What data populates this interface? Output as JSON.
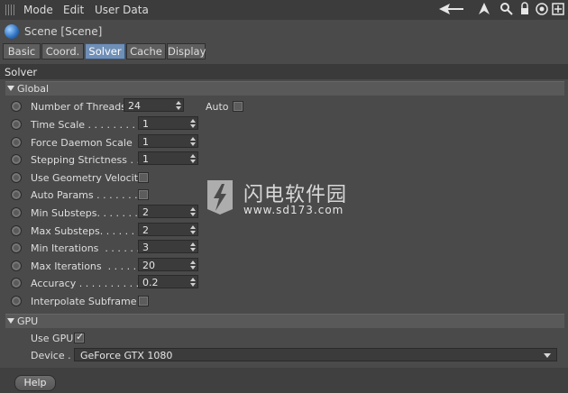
{
  "menu": {
    "items": [
      "Mode",
      "Edit",
      "User Data"
    ]
  },
  "scene": {
    "title": "Scene [Scene]"
  },
  "tabs": [
    {
      "label": "Basic"
    },
    {
      "label": "Coord."
    },
    {
      "label": "Solver",
      "active": true
    },
    {
      "label": "Cache"
    },
    {
      "label": "Display"
    }
  ],
  "solver": {
    "section_title": "Solver",
    "global_title": "Global",
    "threads": {
      "label": "Number of Threads",
      "value": "24",
      "auto_label": "Auto"
    },
    "rows": [
      {
        "label": "Time Scale . . . . . . . . . .",
        "value": "1"
      },
      {
        "label": "Force Daemon Scale  .",
        "value": "1"
      },
      {
        "label": "Stepping Strictness . .",
        "value": "1"
      },
      {
        "label": "Use Geometry Velocity",
        "checkbox": true
      },
      {
        "label": "Auto Params . . . . . . . .",
        "checkbox": true
      },
      {
        "label": "Min Substeps. . . . . . . .",
        "value": "2"
      },
      {
        "label": "Max Substeps. . . . . . . .",
        "value": "2"
      },
      {
        "label": "Min Iterations  . . . . . .",
        "value": "3"
      },
      {
        "label": "Max Iterations  . . . . . .",
        "value": "20"
      },
      {
        "label": "Accuracy . . . . . . . . . . .",
        "value": "0.2"
      },
      {
        "label": "Interpolate Subframe",
        "checkbox": true
      }
    ]
  },
  "gpu": {
    "title": "GPU",
    "use_gpu_label": "Use GPU",
    "device_label": "Device . .",
    "device_value": "GeForce GTX 1080"
  },
  "footer": {
    "help_label": "Help"
  },
  "watermark": {
    "text": "闪电软件园",
    "url": "www.sd173.com"
  },
  "colors": {
    "active_tab": "#6f8fb6",
    "panel": "#4a4a4a"
  }
}
